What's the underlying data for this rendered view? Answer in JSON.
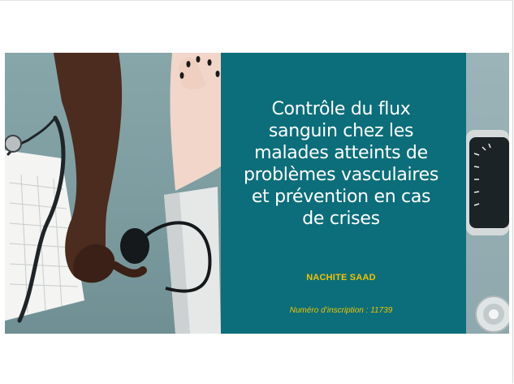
{
  "slide": {
    "title_lines": [
      "Contrôle du flux",
      "sanguin chez les",
      "malades atteints de",
      "problèmes vasculaires",
      "et prévention en cas",
      "de crises"
    ],
    "author": "NACHITE SAAD",
    "inscription": "Numéro d’inscription : 11739"
  },
  "colors": {
    "panel": "#0b6e7a",
    "accent_text": "#f2c200",
    "title_text": "#ffffff"
  },
  "icons": {
    "left_photo": "stethoscope-blood-pressure-photo",
    "right_photo": "sphygmomanometer-gauge-photo"
  }
}
